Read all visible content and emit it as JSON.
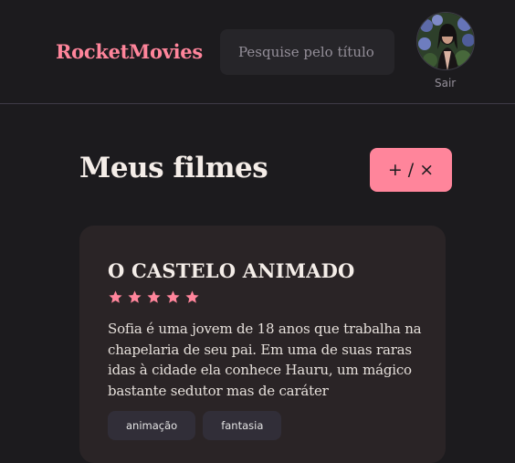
{
  "header": {
    "brand": "RocketMovies",
    "search_placeholder": "Pesquise pelo título",
    "signout_label": "Sair"
  },
  "main": {
    "title": "Meus filmes",
    "add_button_label": "+ / ×"
  },
  "movie": {
    "title": "O CASTELO ANIMADO",
    "rating": 5,
    "synopsis": "Sofia é uma jovem de 18 anos que trabalha na chapelaria de seu pai. Em uma de suas raras idas à cidade ela conhece Hauru, um mágico bastante sedutor mas de caráter",
    "tags": [
      "animação",
      "fantasia"
    ]
  },
  "colors": {
    "background": "#1c1b1e",
    "accent": "#ff859b",
    "card": "#2a2426",
    "tag": "#312e38",
    "input": "#262529",
    "muted": "#948f99"
  }
}
